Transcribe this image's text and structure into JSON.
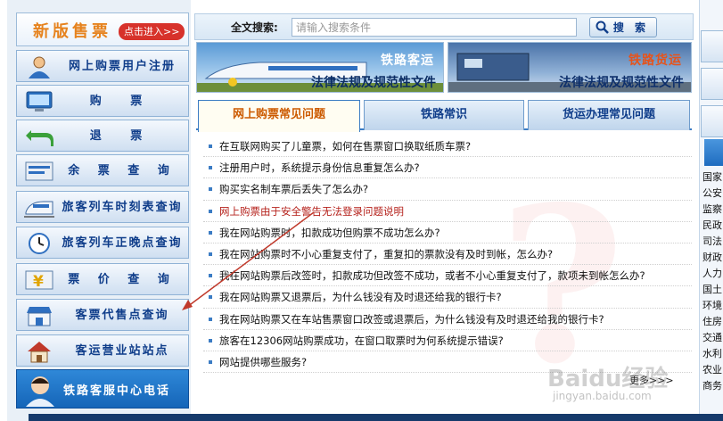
{
  "sidebar": {
    "new_sale": {
      "title": "新版售票",
      "enter": "点击进入>>"
    },
    "items": [
      {
        "label": "网上购票用户注册",
        "icon": "user-register-icon"
      },
      {
        "label": "购 票",
        "icon": "computer-ticket-icon"
      },
      {
        "label": "退 票",
        "icon": "return-arrow-icon"
      },
      {
        "label": "余 票 查 询",
        "icon": "ticket-list-icon"
      },
      {
        "label": "旅客列车时刻表查询",
        "icon": "train-icon"
      },
      {
        "label": "旅客列车正晚点查询",
        "icon": "clock-icon"
      },
      {
        "label": "票 价 查 询",
        "icon": "yuan-price-icon"
      },
      {
        "label": "客票代售点查询",
        "icon": "shop-icon"
      },
      {
        "label": "客运营业站站点",
        "icon": "station-house-icon"
      }
    ],
    "service_phone": "铁路客服中心电话"
  },
  "search": {
    "label": "全文搜索:",
    "placeholder": "请输入搜索条件",
    "button": "搜 索"
  },
  "banners": [
    {
      "title": "铁路客运",
      "subtitle": "法律法规及规范性文件"
    },
    {
      "title": "铁路货运",
      "subtitle": "法律法规及规范性文件"
    }
  ],
  "tabs": [
    {
      "label": "网上购票常见问题",
      "active": true
    },
    {
      "label": "铁路常识",
      "active": false
    },
    {
      "label": "货运办理常见问题",
      "active": false
    }
  ],
  "faq": [
    {
      "text": "在互联网购买了儿童票，如何在售票窗口换取纸质车票?",
      "highlight": false
    },
    {
      "text": "注册用户时，系统提示身份信息重复怎么办?",
      "highlight": false
    },
    {
      "text": "购买实名制车票后丢失了怎么办?",
      "highlight": false
    },
    {
      "text": "网上购票由于安全警告无法登录问题说明",
      "highlight": true
    },
    {
      "text": "我在网站购票时，扣款成功但购票不成功怎么办?",
      "highlight": false
    },
    {
      "text": "我在网站购票时不小心重复支付了，重复扣的票款没有及时到帐，怎么办?",
      "highlight": false
    },
    {
      "text": "我在网站购票后改签时，扣款成功但改签不成功，或者不小心重复支付了，款项未到帐怎么办?",
      "highlight": false
    },
    {
      "text": "我在网站购票又退票后，为什么钱没有及时退还给我的银行卡?",
      "highlight": false
    },
    {
      "text": "我在网站购票又在车站售票窗口改签或退票后，为什么钱没有及时退还给我的银行卡?",
      "highlight": false
    },
    {
      "text": "旅客在12306网站购票成功，在窗口取票时为何系统提示错误?",
      "highlight": false
    },
    {
      "text": "网站提供哪些服务?",
      "highlight": false
    }
  ],
  "more": "更多>>>",
  "right_links": [
    "国家",
    "公安",
    "监察",
    "民政",
    "司法",
    "财政",
    "人力",
    "国土",
    "环境",
    "住房",
    "交通",
    "水利",
    "农业",
    "商务"
  ],
  "watermark": {
    "brand": "Baidu经验",
    "url": "jingyan.baidu.com"
  },
  "colors": {
    "accent": "#0f3d8a",
    "active_tab_text": "#cc5a00",
    "highlight": "#b5211b",
    "arrow": "#c0392b"
  }
}
